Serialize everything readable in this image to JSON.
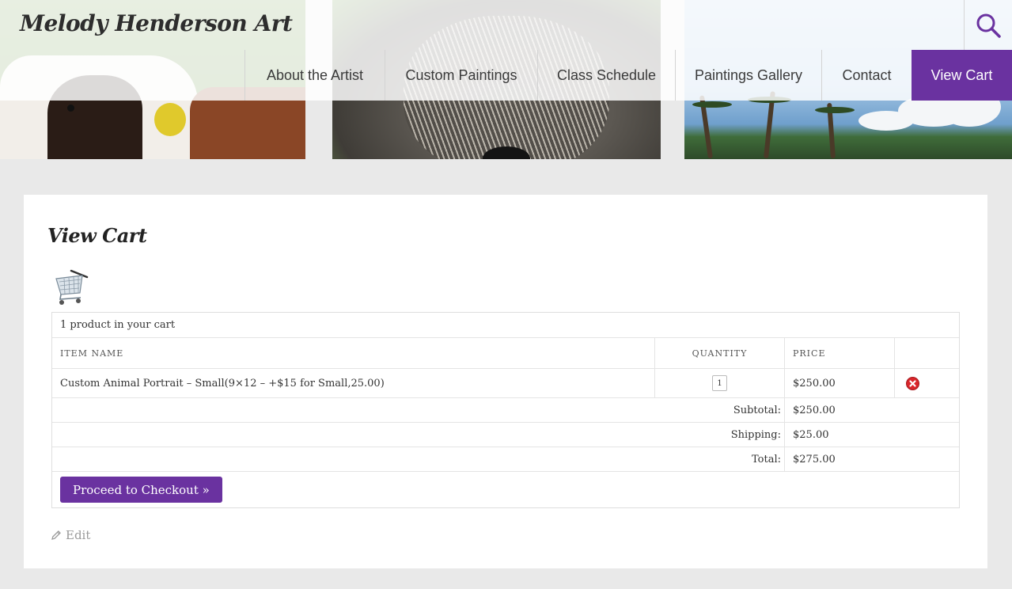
{
  "site": {
    "title": "Melody Henderson Art"
  },
  "nav": {
    "items": [
      {
        "label": "About the Artist"
      },
      {
        "label": "Custom Paintings"
      },
      {
        "label": "Class Schedule"
      },
      {
        "label": "Paintings Gallery"
      },
      {
        "label": "Contact"
      },
      {
        "label": "View Cart",
        "active": true
      }
    ]
  },
  "page": {
    "title": "View Cart"
  },
  "cart": {
    "summary_text": "1 product in your cart",
    "columns": {
      "item": "ITEM NAME",
      "quantity": "QUANTITY",
      "price": "PRICE"
    },
    "items": [
      {
        "name": "Custom Animal Portrait – Small(9×12 – +$15 for Small,25.00)",
        "quantity": "1",
        "price": "$250.00"
      }
    ],
    "subtotal_label": "Subtotal:",
    "subtotal": "$250.00",
    "shipping_label": "Shipping:",
    "shipping": "$25.00",
    "total_label": "Total:",
    "total": "$275.00",
    "checkout_label": "Proceed to Checkout »"
  },
  "edit_label": "Edit",
  "colors": {
    "accent": "#6a32a0",
    "remove": "#d9262b"
  }
}
